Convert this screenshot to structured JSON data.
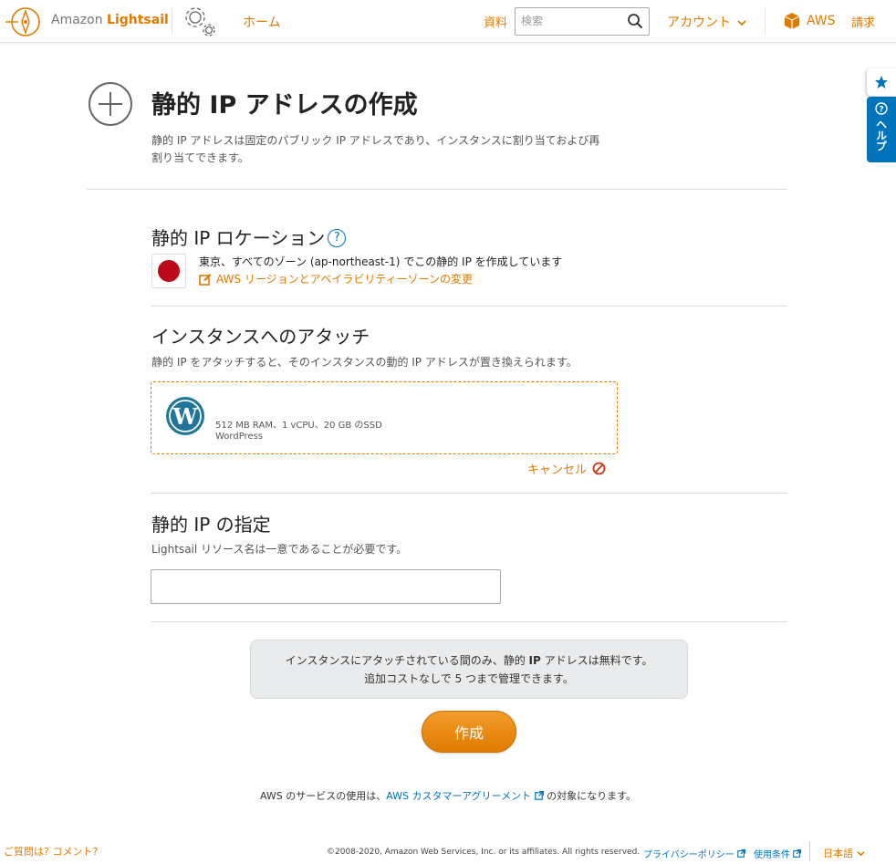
{
  "header": {
    "brand_prefix": "Amazon ",
    "brand_name": "Lightsail",
    "home_label": "ホーム",
    "docs_label": "資料",
    "search_placeholder": "検索",
    "account_label": "アカウント",
    "aws_label": "AWS",
    "billing_label": "請求"
  },
  "side_tabs": {
    "help_label": "ヘルプ"
  },
  "page": {
    "title": "静的 IP アドレスの作成",
    "description": "静的 IP アドレスは固定のパブリック IP アドレスであり、インスタンスに割り当ておよび再割り当てできます。"
  },
  "location_section": {
    "heading": "静的 IP ロケーション",
    "help_glyph": "?",
    "location_text": "東京、すべてのゾーン (ap-northeast-1) でこの静的 IP を作成しています",
    "change_link": "AWS リージョンとアベイラビリティーゾーンの変更"
  },
  "attach_section": {
    "heading": "インスタンスへのアタッチ",
    "description": "静的 IP をアタッチすると、そのインスタンスの動的 IP アドレスが置き換えられます。",
    "instance": {
      "name": "",
      "specs": "512 MB RAM、1 vCPU、20 GB のSSD",
      "blueprint": "WordPress"
    },
    "cancel_label": "キャンセル"
  },
  "name_section": {
    "heading": "静的 IP の指定",
    "description": "Lightsail リソース名は一意であることが必要です。",
    "value": ""
  },
  "info": {
    "line1_pre": "インスタンスにアタッチされている間のみ、静的 ",
    "line1_bold": "IP",
    "line1_post": " アドレスは無料です。",
    "line2": "追加コストなしで 5 つまで管理できます。"
  },
  "create_button": "作成",
  "terms": {
    "prefix": "AWS のサービスの使用は、",
    "link": "AWS カスタマーアグリーメント",
    "suffix": " の対象になります。"
  },
  "footer": {
    "feedback": "ご質問は? コメント?",
    "copyright": "©2008-2020, Amazon Web Services, Inc. or its affiliates. All rights reserved.",
    "privacy": "プライバシーポリシー",
    "terms_of_use": "使用条件",
    "language": "日本語"
  },
  "colors": {
    "accent": "#e07b00",
    "link": "#0073bb",
    "flag_red": "#bc0a1a"
  }
}
